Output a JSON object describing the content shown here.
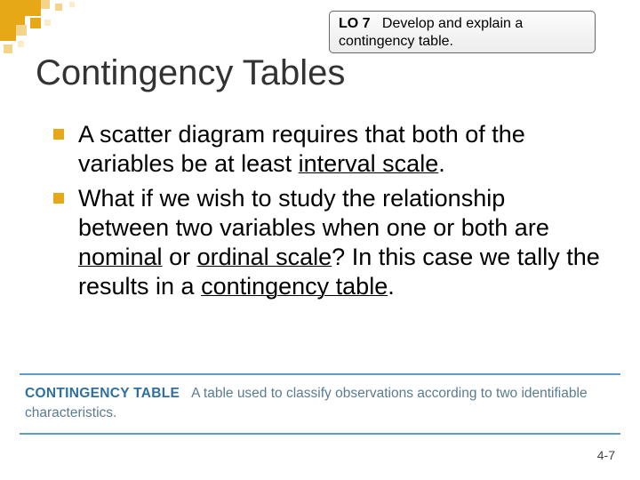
{
  "lo": {
    "label": "LO 7",
    "text": "Develop and explain a contingency table."
  },
  "title": "Contingency Tables",
  "bullets": {
    "b1_pre": "A scatter diagram requires that both of the variables be at least ",
    "b1_u": "interval scale",
    "b1_post": ".",
    "b2_a": "What if we wish to study the relationship between two variables when one or both are ",
    "b2_u1": "nominal",
    "b2_mid": " or ",
    "b2_u2": "ordinal scale",
    "b2_q": "? In this case we tally the results in a ",
    "b2_u3": "contingency table",
    "b2_end": "."
  },
  "definition": {
    "term": "CONTINGENCY TABLE",
    "text": "A table used to classify observations according to two identifiable characteristics."
  },
  "footer": "4-7"
}
